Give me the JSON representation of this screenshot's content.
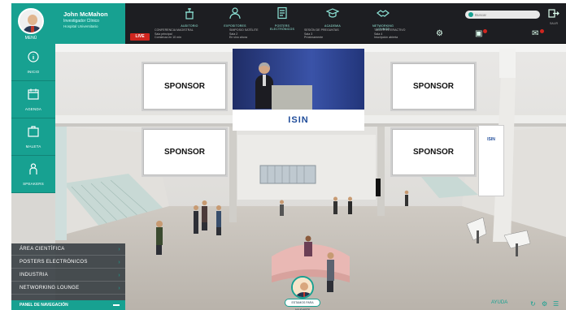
{
  "user": {
    "name": "John McMahon",
    "role": "Investigador Clínico",
    "org": "Hospital Universitario",
    "avatar_caption": "MENÚ"
  },
  "top_nav": [
    {
      "icon": "podium-icon",
      "label": "AUDITORIO"
    },
    {
      "icon": "doctor-icon",
      "label": "EXPOSITORES"
    },
    {
      "icon": "document-icon",
      "label": "POSTERS ELECTRÓNICOS"
    },
    {
      "icon": "mortar-icon",
      "label": "ACADEMIA"
    },
    {
      "icon": "handshake-icon",
      "label": "NETWORKING LOUNGE"
    }
  ],
  "search": {
    "placeholder": "Buscar"
  },
  "exit_label": "SALIR",
  "live_label": "LIVE",
  "ticker": [
    {
      "title": "CONFERENCIA MAGISTRAL",
      "line2": "Sala principal",
      "line3": "Comienza en 10 min"
    },
    {
      "title": "SIMPOSIO SATÉLITE",
      "line2": "Sala 2",
      "line3": "En vivo ahora"
    },
    {
      "title": "SESIÓN DE PREGUNTAS",
      "line2": "Sala 3",
      "line3": "Próximamente"
    },
    {
      "title": "TALLER INTERACTIVO",
      "line2": "Sala 4",
      "line3": "Inscripción abierta"
    }
  ],
  "side_nav": [
    {
      "icon": "info-icon",
      "label": "INICIO"
    },
    {
      "icon": "calendar-icon",
      "label": "AGENDA"
    },
    {
      "icon": "briefcase-icon",
      "label": "MALETA"
    },
    {
      "icon": "speaker-icon",
      "label": "SPEAKERS"
    }
  ],
  "sponsors": [
    "SPONSOR",
    "SPONSOR",
    "SPONSOR",
    "SPONSOR"
  ],
  "screen_logo": "ISIN",
  "banner_logo": "ISIN",
  "menu": {
    "items": [
      "ÁREA CIENTÍFICA",
      "POSTERS ELECTRÓNICOS",
      "INDUSTRIA",
      "NETWORKING LOUNGE"
    ],
    "footer": "PANEL DE NAVEGACIÓN"
  },
  "concierge_tag": "ESTAMOS PARA AYUDARTE",
  "bottom_right": {
    "label": "AYUDA"
  },
  "colors": {
    "accent": "#17a191",
    "topbar": "#1d1e22",
    "live": "#d0261f"
  }
}
